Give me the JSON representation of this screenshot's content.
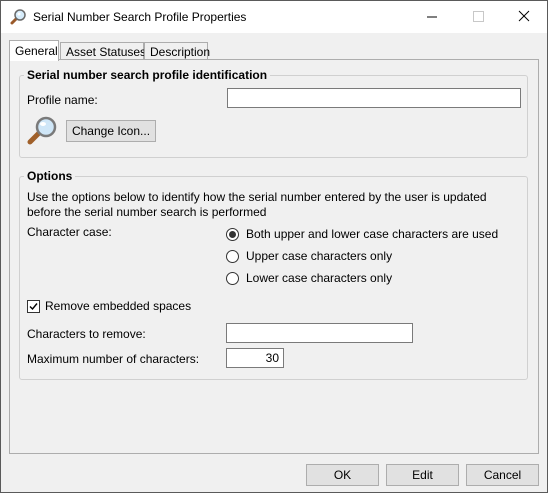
{
  "window": {
    "title": "Serial Number Search Profile Properties"
  },
  "tabs": [
    {
      "label": "General",
      "active": true
    },
    {
      "label": "Asset Statuses",
      "active": false
    },
    {
      "label": "Description",
      "active": false
    }
  ],
  "identification": {
    "group_title": "Serial number search profile identification",
    "profile_name_label": "Profile name:",
    "profile_name_value": "",
    "change_icon_label": "Change Icon..."
  },
  "options": {
    "group_title": "Options",
    "description": "Use the options below to identify how the serial number entered by the user is updated before the serial number search is performed",
    "character_case_label": "Character case:",
    "case_options": [
      {
        "label": "Both upper and lower case characters are used",
        "selected": true
      },
      {
        "label": "Upper case characters only",
        "selected": false
      },
      {
        "label": "Lower case characters only",
        "selected": false
      }
    ],
    "remove_spaces_label": "Remove embedded spaces",
    "remove_spaces_checked": true,
    "chars_to_remove_label": "Characters to remove:",
    "chars_to_remove_value": "",
    "max_chars_label": "Maximum number of characters:",
    "max_chars_value": "30"
  },
  "footer": {
    "ok_label": "OK",
    "edit_label": "Edit",
    "cancel_label": "Cancel"
  }
}
